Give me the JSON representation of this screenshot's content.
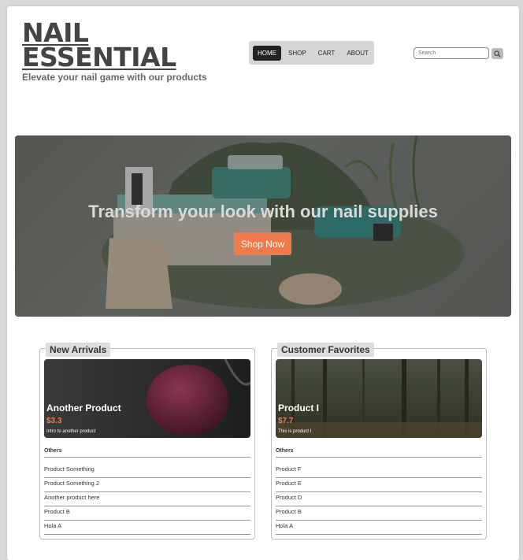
{
  "brand": {
    "line1": "NAIL",
    "line2": "ESSENTIAL",
    "tagline": "Elevate your nail game with our products"
  },
  "nav": {
    "items": [
      "HOME",
      "SHOP",
      "CART",
      "ABOUT"
    ],
    "active": "HOME"
  },
  "search": {
    "placeholder": "Search"
  },
  "hero": {
    "headline": "Transform your look with our nail supplies",
    "cta": "Shop Now"
  },
  "panels": [
    {
      "title": "New Arrivals",
      "featured": {
        "name": "Another Product",
        "price": "$3.3",
        "desc": "Intro to another product"
      },
      "others_label": "Others",
      "items": [
        "Product Something",
        "Product Something 2",
        "Another product here",
        "Product B",
        "Hola A"
      ]
    },
    {
      "title": "Customer Favorites",
      "featured": {
        "name": "Product I",
        "price": "$7.7",
        "desc": "This is product I"
      },
      "others_label": "Others",
      "items": [
        "Product F",
        "Product E",
        "Product D",
        "Product B",
        "Hola A"
      ]
    }
  ],
  "colors": {
    "accent": "#f07a4a",
    "nav_active": "#222222"
  }
}
